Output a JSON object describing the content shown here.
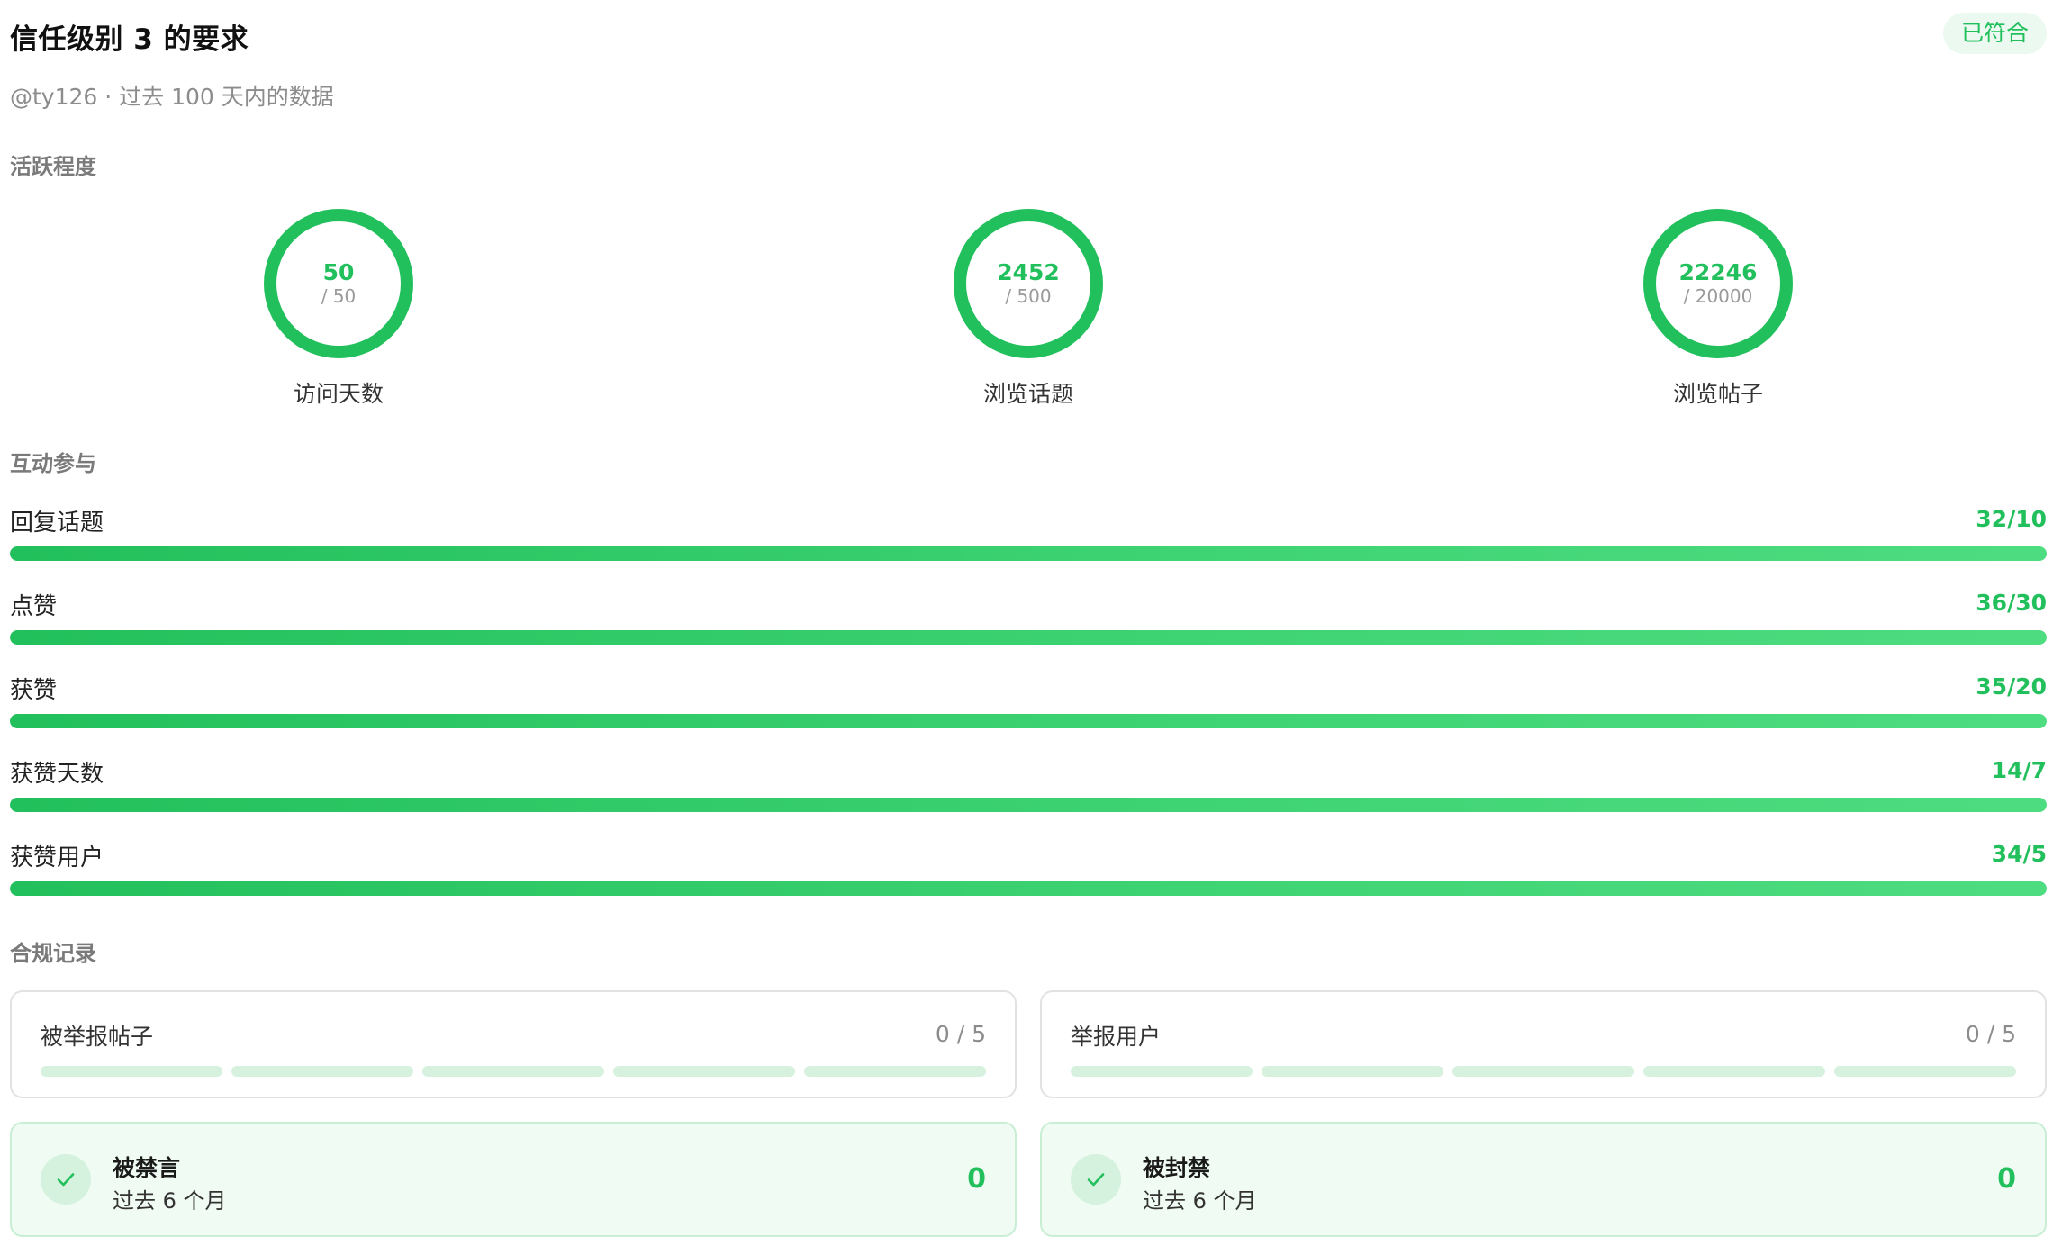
{
  "header": {
    "title": "信任级别 3 的要求",
    "status_badge": "已符合",
    "subtitle": "@ty126 · 过去 100 天内的数据"
  },
  "sections": {
    "activity": "活跃程度",
    "interaction": "互动参与",
    "compliance": "合规记录"
  },
  "activity": [
    {
      "value": "50",
      "target": "/ 50",
      "label": "访问天数",
      "progress": 1.0
    },
    {
      "value": "2452",
      "target": "/ 500",
      "label": "浏览话题",
      "progress": 1.0
    },
    {
      "value": "22246",
      "target": "/ 20000",
      "label": "浏览帖子",
      "progress": 1.0
    }
  ],
  "interaction": [
    {
      "label": "回复话题",
      "value": "32/10",
      "progress": 1.0
    },
    {
      "label": "点赞",
      "value": "36/30",
      "progress": 1.0
    },
    {
      "label": "获赞",
      "value": "35/20",
      "progress": 1.0
    },
    {
      "label": "获赞天数",
      "value": "14/7",
      "progress": 1.0
    },
    {
      "label": "获赞用户",
      "value": "34/5",
      "progress": 1.0
    }
  ],
  "compliance": {
    "reports": [
      {
        "label": "被举报帖子",
        "count": "0 / 5",
        "filled": 0,
        "segments": 5
      },
      {
        "label": "举报用户",
        "count": "0 / 5",
        "filled": 0,
        "segments": 5
      }
    ],
    "penalties": [
      {
        "title": "被禁言",
        "period": "过去 6 个月",
        "count": "0"
      },
      {
        "title": "被封禁",
        "period": "过去 6 个月",
        "count": "0"
      }
    ]
  },
  "colors": {
    "accent": "#22c05c",
    "track": "#e3f5e9",
    "segment_empty": "#d7f1df",
    "status_bg": "#f0fbf3"
  }
}
